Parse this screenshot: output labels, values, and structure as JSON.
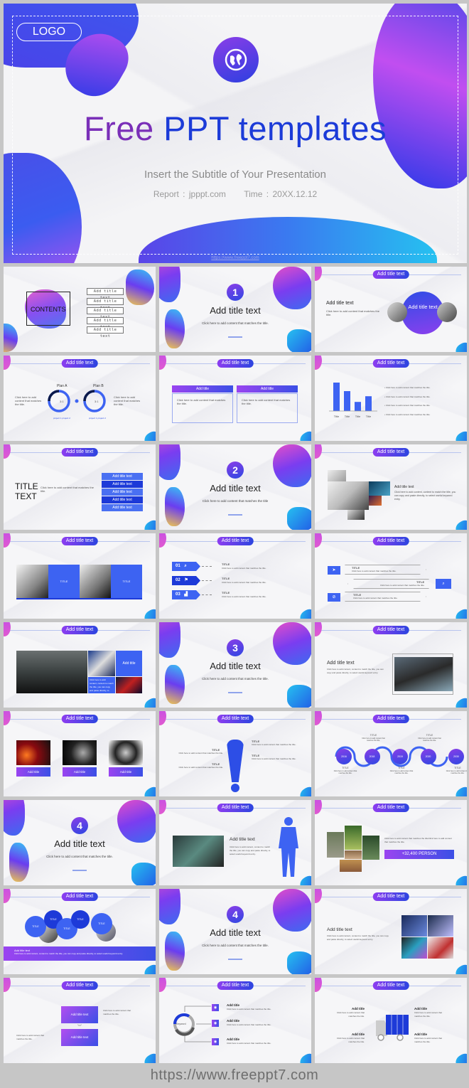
{
  "title_slide": {
    "logo": "LOGO",
    "icon": "globe-icon",
    "title_word1": "Free",
    "title_word2": "PPT templates",
    "subtitle": "Insert  the  Subtitle  of Your  Presentation",
    "report": "Report :  jpppt.com",
    "time": "Time :  20XX.12.12",
    "watermark": "https://www.freeppt7.com"
  },
  "common": {
    "header_pill": "Add title text",
    "add_title_text": "Add title text",
    "add_title": "Add title",
    "click_here": "Click here to add content that matches the title.",
    "click_here_long": "Click here to add content, content to match the title, you can copy and paste directly, to select useful keyword entry.",
    "title_caps": "TITLE"
  },
  "slides": {
    "contents": {
      "label": "CONTENTS",
      "items": [
        "Add title text",
        "Add title text",
        "Add title text",
        "Add title text",
        "Add title text"
      ]
    },
    "section1": {
      "number": "1",
      "title": "Add title text",
      "subtitle": "Click here to add content that matches the title."
    },
    "circle_slide": {
      "left_title": "Add title text",
      "circle_text": "Add title text"
    },
    "plans": {
      "plan_a": "Plan A",
      "plan_b": "Plan B",
      "ratio_a": "3:1",
      "ratio_b": "3:1",
      "legend_1": "project 1",
      "legend_2": "project 2",
      "fill_fraction": 0.25
    },
    "two_boxes": {
      "box1_title": "Add title",
      "box2_title": "Add title",
      "box_text": "Click here to add content  that matches the title."
    },
    "bar_chart": {
      "categories": [
        "Title",
        "Title",
        "Title",
        "Title"
      ],
      "values": [
        5,
        3.5,
        1.6,
        2.6
      ],
      "bullets": [
        "Click here to add content that matches the title.",
        "Click here to add content that matches the title.",
        "Click here to add content that matches the title.",
        "Click here to add content that matches the title."
      ]
    },
    "title_text": {
      "title_line1": "TITLE",
      "title_line2": "TEXT",
      "items": [
        "Add title text",
        "Add title text",
        "Add title text",
        "Add title text",
        "Add title text"
      ]
    },
    "section2": {
      "number": "2",
      "title": "Add title text",
      "subtitle": "Click here to add content that matches the title"
    },
    "collage": {
      "title": "Add title text"
    },
    "meeting": {
      "label1": "TITLE",
      "label2": "TITLE"
    },
    "numbered": {
      "items": [
        {
          "num": "01",
          "icon": "search-icon"
        },
        {
          "num": "02",
          "icon": "flag-icon"
        },
        {
          "num": "03",
          "icon": "chart-icon"
        }
      ]
    },
    "arrows": {
      "icons": [
        "send-icon",
        "search-icon",
        "paperclip-icon"
      ]
    },
    "driving": {
      "box_title": "Add title"
    },
    "section3": {
      "number": "3",
      "title": "Add title text",
      "subtitle": "Click here to add content that matches the title."
    },
    "coast": {
      "title": "Add title text"
    },
    "cars": {
      "labels": [
        "Add title",
        "Add title",
        "Add title"
      ]
    },
    "exclaim": {},
    "timeline": {
      "years": [
        "2016",
        "2018",
        "2019",
        "2020",
        "2030"
      ]
    },
    "section4a": {
      "number": "4",
      "title": "Add title text",
      "subtitle": "Click here to add content that matches the title."
    },
    "silhouette": {
      "title": "Add title text"
    },
    "persons": {
      "count": "+32,400 PERSON",
      "text": "Click here to add content that matches the titleClick here to add content that matches the title."
    },
    "bubbles": {
      "labels": [
        "TITLE",
        "TITLE",
        "TITLE",
        "TITLE",
        "TITLE"
      ],
      "band_title": "Add title text"
    },
    "section4b": {
      "number": "4",
      "title": "Add title text",
      "subtitle": "Click here to add content that matches the title."
    },
    "quad": {
      "title": "Add title text"
    },
    "flow": {
      "box1": "Add title text",
      "box2": "Add title text"
    },
    "keyword": {
      "center": "Keyword",
      "items": [
        "Add title",
        "Add title",
        "Add title"
      ]
    },
    "truck": {
      "items": [
        "Add title",
        "Add title",
        "Add title",
        "Add title"
      ]
    }
  },
  "footer": {
    "url": "https://www.freeppt7.com"
  }
}
